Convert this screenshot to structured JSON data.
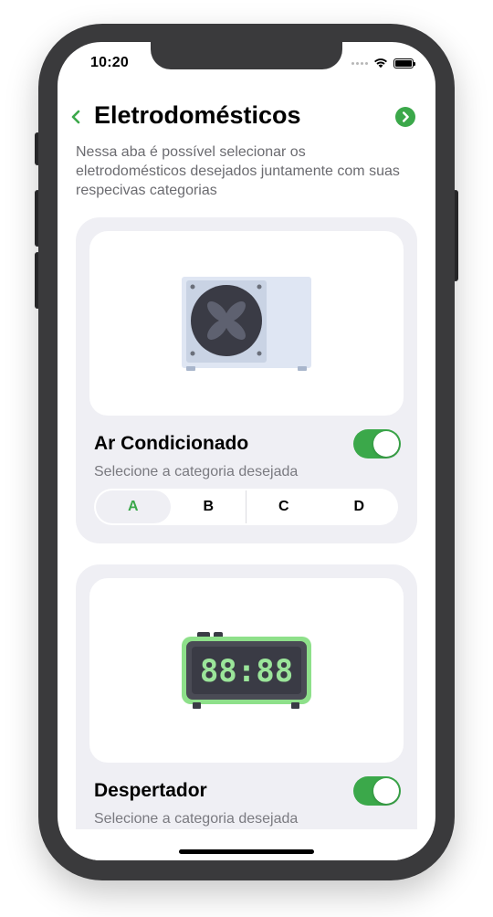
{
  "status_bar": {
    "time": "10:20",
    "icons": [
      "signal-icon",
      "wifi-icon",
      "battery-icon"
    ]
  },
  "header": {
    "title": "Eletrodomésticos",
    "back_icon": "chevron-left-icon",
    "next_icon": "chevron-right-circle-icon"
  },
  "description": "Nessa aba é possível selecionar os eletrodomésticos desejados juntamente com suas respecivas categorias",
  "appliances": [
    {
      "name": "Ar Condicionado",
      "image_icon": "air-conditioner-icon",
      "subtitle": "Selecione a categoria desejada",
      "enabled": true,
      "categories": [
        "A",
        "B",
        "C",
        "D"
      ],
      "selected_category": "A"
    },
    {
      "name": "Despertador",
      "image_icon": "alarm-clock-icon",
      "clock_display": "88:88",
      "subtitle": "Selecione a categoria desejada",
      "enabled": true
    }
  ],
  "colors": {
    "accent": "#3ba84a",
    "card_bg": "#efeff4",
    "clock_glow": "#8ee08a",
    "clock_digits": "#9be59a"
  }
}
